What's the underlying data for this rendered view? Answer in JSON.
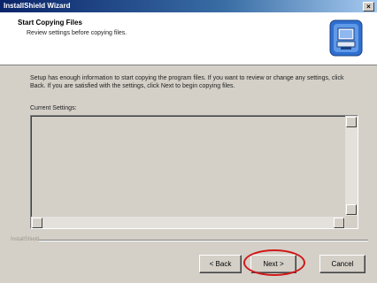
{
  "window": {
    "title": "InstallShield Wizard",
    "close_label": "×"
  },
  "header": {
    "title": "Start Copying Files",
    "subtitle": "Review settings before copying files.",
    "icon": "setup-computer-icon"
  },
  "main": {
    "description": "Setup has enough information to start copying the program files. If you want to review or change any settings, click Back. If you are satisfied with the settings, click Next to begin copying files.",
    "current_settings_label": "Current Settings:",
    "current_settings_text": ""
  },
  "footer": {
    "brand": "InstallShield",
    "back_label": "< Back",
    "next_label": "Next >",
    "cancel_label": "Cancel",
    "highlight_color": "#d01818"
  }
}
